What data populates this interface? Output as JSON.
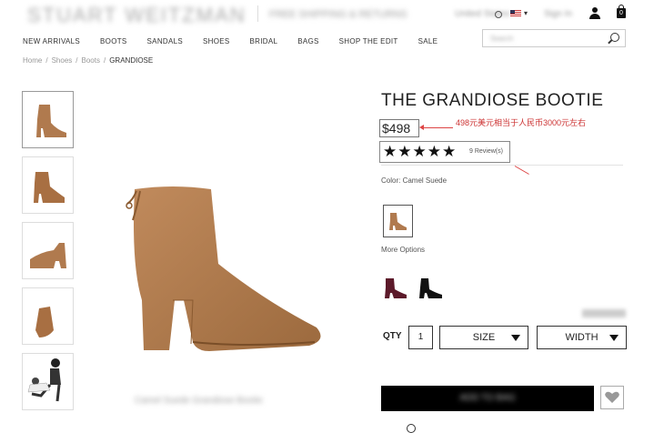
{
  "header": {
    "logo": "STUART WEITZMAN",
    "tagline": "FREE SHIPPING & RETURNS",
    "region": "United States",
    "account": "Sign In"
  },
  "nav": {
    "items": [
      "NEW ARRIVALS",
      "BOOTS",
      "SANDALS",
      "SHOES",
      "BRIDAL",
      "BAGS",
      "SHOP THE EDIT",
      "SALE"
    ],
    "search_placeholder": "Search"
  },
  "breadcrumb": [
    "Home",
    "Shoes",
    "Boots",
    "GRANDIOSE"
  ],
  "product": {
    "title": "THE GRANDIOSE BOOTIE",
    "price": "$498",
    "annotation": "498元美元相当于人民币3000元左右",
    "stars": "★★★★★",
    "reviews": "9 Review(s)",
    "color_label": "Color: Camel Suede",
    "more_options": "More Options",
    "qty_label": "QTY",
    "qty_value": "1",
    "size_label": "SIZE",
    "width_label": "WIDTH",
    "add_to_bag": "ADD TO BAG",
    "image_caption": "Camel Suede Grandiose Bootie"
  },
  "colors": {
    "camel": "#b07a4e",
    "burgundy": "#5c1a2a",
    "black": "#111111",
    "annotation_red": "#cc3333"
  }
}
